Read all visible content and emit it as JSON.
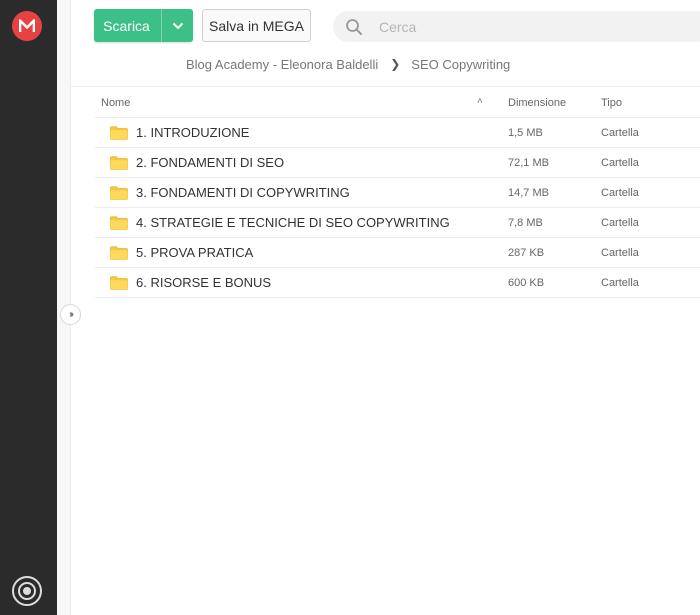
{
  "sidebar": {
    "logo_letter": "M",
    "logo_color": "#e74242"
  },
  "toolbar": {
    "download_label": "Scarica",
    "save_label": "Salva in MEGA",
    "download_color": "#3dbf88"
  },
  "search": {
    "placeholder": "Cerca",
    "value": ""
  },
  "breadcrumb": {
    "items": [
      "Blog Academy - Eleonora Baldelli",
      "SEO Copywriting"
    ]
  },
  "table": {
    "columns": {
      "name": "Nome",
      "size": "Dimensione",
      "type": "Tipo"
    },
    "rows": [
      {
        "name": "1. INTRODUZIONE",
        "size": "1,5 MB",
        "type": "Cartella"
      },
      {
        "name": "2. FONDAMENTI DI SEO",
        "size": "72,1 MB",
        "type": "Cartella"
      },
      {
        "name": "3. FONDAMENTI DI COPYWRITING",
        "size": "14,7 MB",
        "type": "Cartella"
      },
      {
        "name": "4. STRATEGIE E TECNICHE DI SEO COPYWRITING",
        "size": "7,8 MB",
        "type": "Cartella"
      },
      {
        "name": "5. PROVA PRATICA",
        "size": "287 KB",
        "type": "Cartella"
      },
      {
        "name": "6. RISORSE E BONUS",
        "size": "600 KB",
        "type": "Cartella"
      }
    ]
  },
  "folder_color": "#f5c842"
}
